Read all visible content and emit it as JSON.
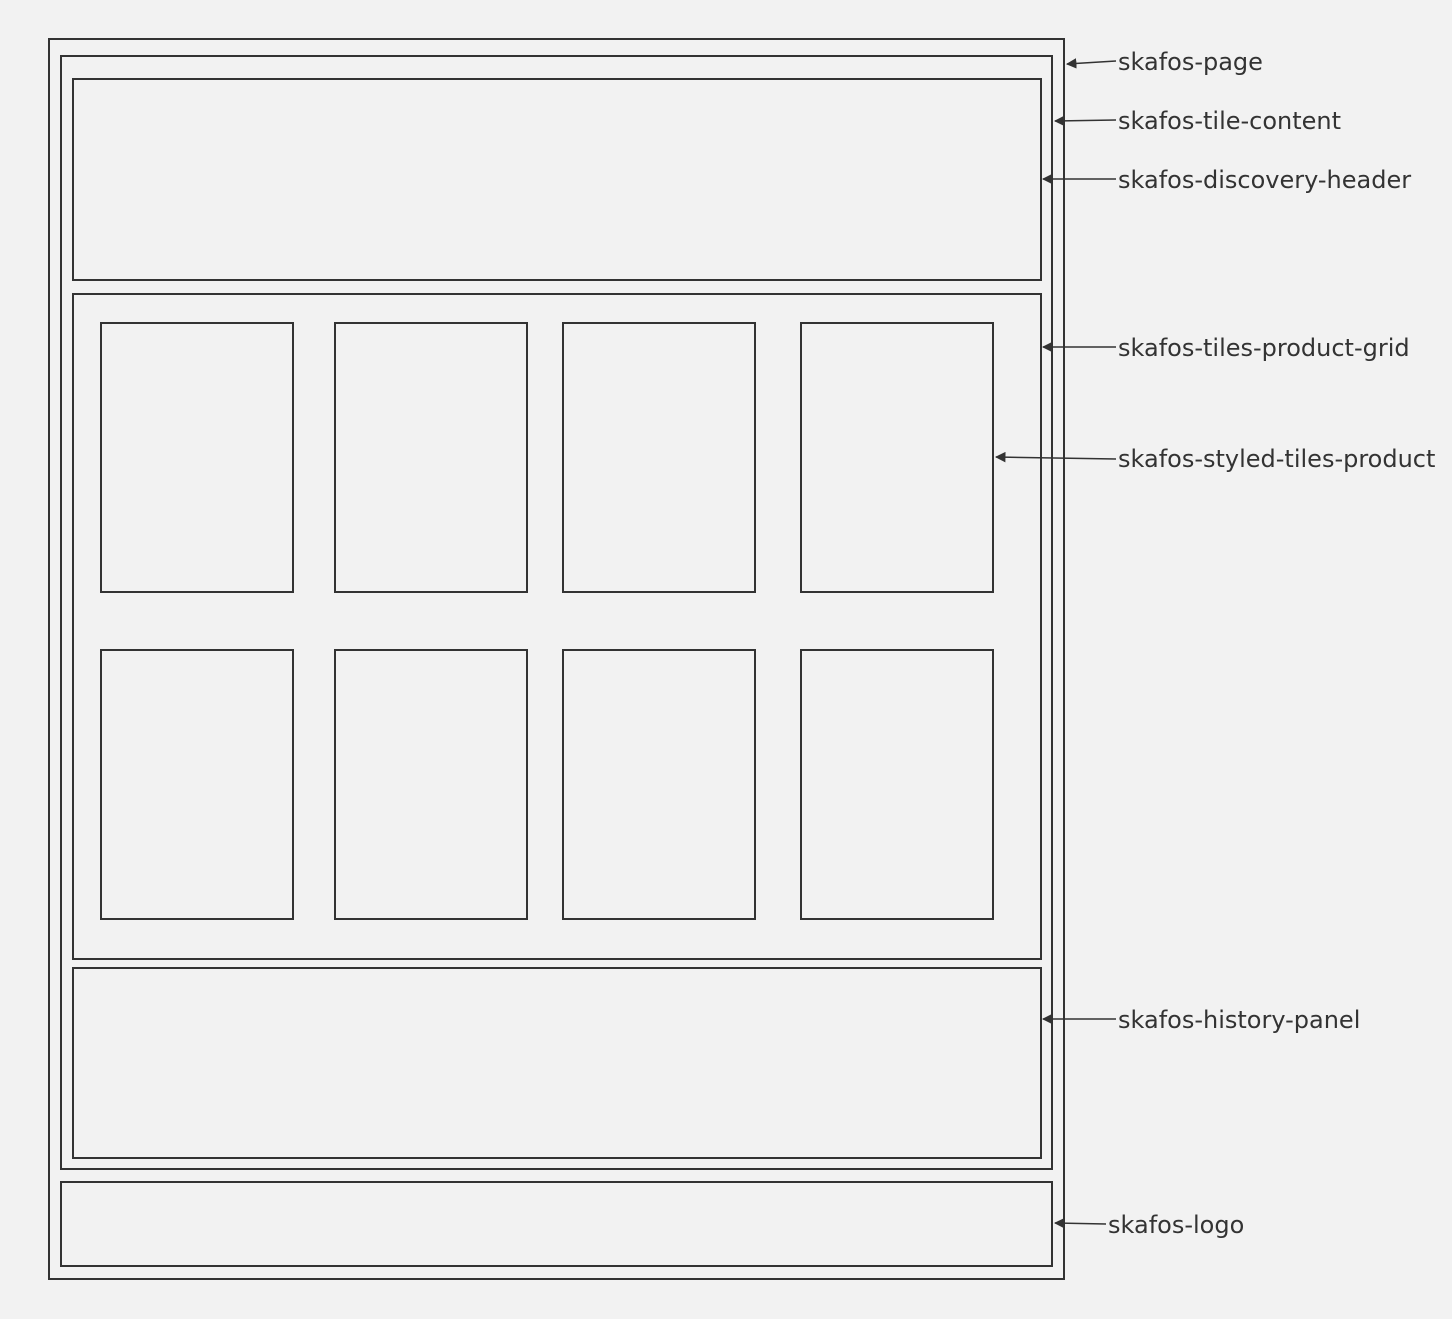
{
  "diagram": {
    "labels": {
      "page": "skafos-page",
      "tile_content": "skafos-tile-content",
      "discovery_header": "skafos-discovery-header",
      "tiles_product_grid": "skafos-tiles-product-grid",
      "styled_tiles_product": "skafos-styled-tiles-product",
      "history_panel": "skafos-history-panel",
      "logo": "skafos-logo"
    },
    "colors": {
      "background": "#f2f2f2",
      "stroke": "#333333"
    }
  }
}
